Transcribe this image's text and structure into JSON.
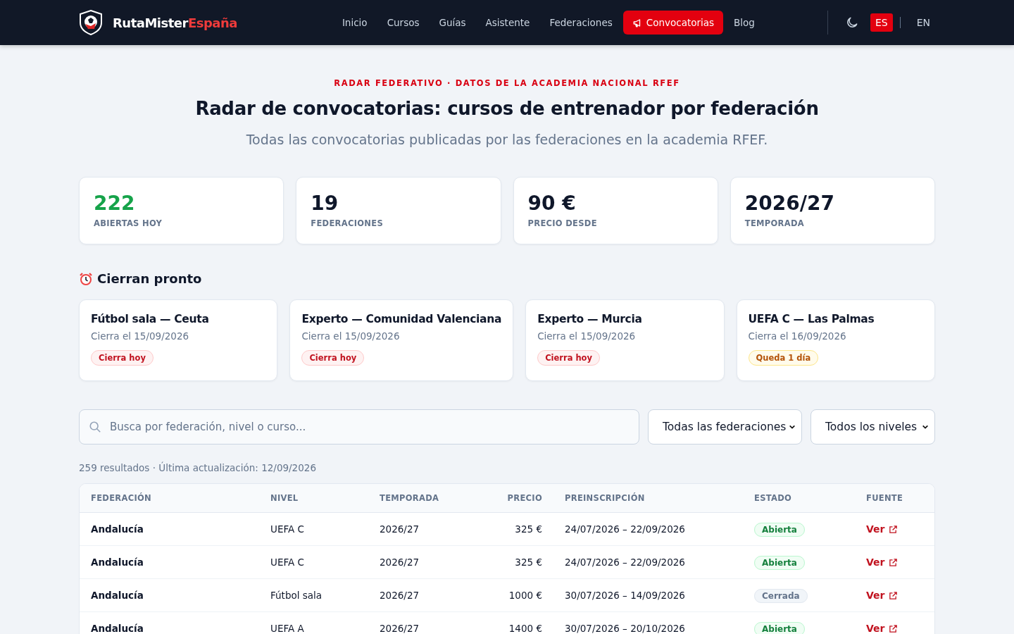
{
  "nav": {
    "brand": {
      "main": "RutaMister",
      "accent": "España"
    },
    "links": [
      {
        "label": "Inicio",
        "selected": false
      },
      {
        "label": "Cursos",
        "selected": false
      },
      {
        "label": "Guías",
        "selected": false
      },
      {
        "label": "Asistente",
        "selected": false
      },
      {
        "label": "Federaciones",
        "selected": false
      },
      {
        "label": "Convocatorias",
        "selected": true
      },
      {
        "label": "Blog",
        "selected": false
      }
    ],
    "languages": [
      {
        "label": "ES",
        "selected": true
      },
      {
        "label": "EN",
        "selected": false
      }
    ]
  },
  "header": {
    "eyebrow": "RADAR FEDERATIVO · DATOS DE LA ACADEMIA NACIONAL RFEF",
    "title": "Radar de convocatorias: cursos de entrenador por federación",
    "subtitle": "Todas las convocatorias publicadas por las federaciones en la academia RFEF."
  },
  "stats": [
    {
      "value": "222",
      "label": "ABIERTAS HOY",
      "kind": "highlight"
    },
    {
      "value": "19",
      "label": "FEDERACIONES",
      "kind": "plain"
    },
    {
      "value": "90 €",
      "label": "PRECIO DESDE",
      "kind": "plain"
    },
    {
      "value": "2026/27",
      "label": "TEMPORADA",
      "kind": "plain"
    }
  ],
  "closing_soon": {
    "title": "Cierran pronto",
    "items": [
      {
        "title": "Fútbol sala — Ceuta",
        "date": "Cierra el 15/09/2026",
        "badge": "Cierra hoy",
        "kind": "today"
      },
      {
        "title": "Experto — Comunidad Valenciana",
        "date": "Cierra el 15/09/2026",
        "badge": "Cierra hoy",
        "kind": "today"
      },
      {
        "title": "Experto — Murcia",
        "date": "Cierra el 15/09/2026",
        "badge": "Cierra hoy",
        "kind": "today"
      },
      {
        "title": "UEFA C — Las Palmas",
        "date": "Cierra el 16/09/2026",
        "badge": "Queda 1 día",
        "kind": "soon"
      }
    ]
  },
  "filters": {
    "search": {
      "placeholder": "Busca por federación, nivel o curso..."
    },
    "federation": "Todas las federaciones",
    "level": "Todos los niveles"
  },
  "results": "259 resultados · Última actualización: 12/09/2026",
  "table": {
    "columns": [
      "FEDERACIÓN",
      "NIVEL",
      "TEMPORADA",
      "PRECIO",
      "PREINSCRIPCIÓN",
      "ESTADO",
      "FUENTE"
    ],
    "rows": [
      {
        "federation": "Andalucía",
        "level": "UEFA C",
        "season": "2026/27",
        "price": "325 €",
        "dates": "24/07/2026 – 22/09/2026",
        "status": "Abierta",
        "kind": "open",
        "source": "Ver"
      },
      {
        "federation": "Andalucía",
        "level": "UEFA C",
        "season": "2026/27",
        "price": "325 €",
        "dates": "24/07/2026 – 22/09/2026",
        "status": "Abierta",
        "kind": "open",
        "source": "Ver"
      },
      {
        "federation": "Andalucía",
        "level": "Fútbol sala",
        "season": "2026/27",
        "price": "1000 €",
        "dates": "30/07/2026 – 14/09/2026",
        "status": "Cerrada",
        "kind": "closed",
        "source": "Ver"
      },
      {
        "federation": "Andalucía",
        "level": "UEFA A",
        "season": "2026/27",
        "price": "1400 €",
        "dates": "30/07/2026 – 20/10/2026",
        "status": "Abierta",
        "kind": "open",
        "source": "Ver"
      }
    ]
  }
}
